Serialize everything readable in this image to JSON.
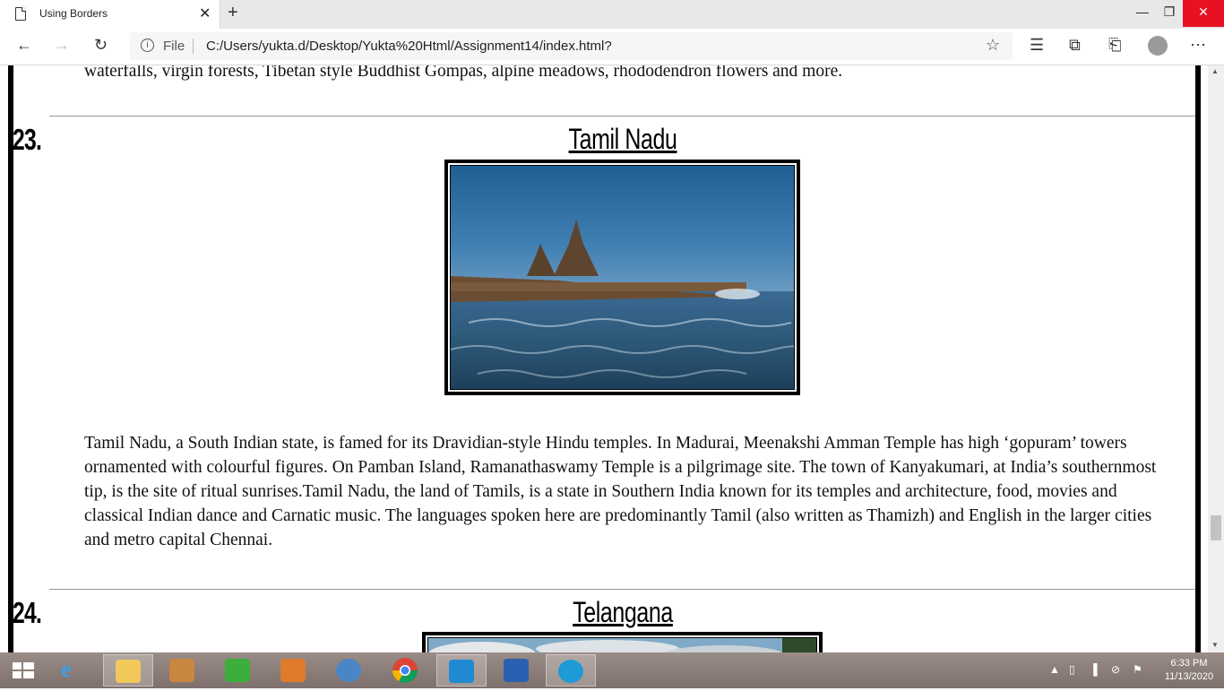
{
  "browser": {
    "tab_title": "Using Borders",
    "tab_close": "✕",
    "new_tab": "+",
    "scheme_label": "File",
    "url": "C:/Users/yukta.d/Desktop/Yukta%20Html/Assignment14/index.html?",
    "window_controls": {
      "minimize": "—",
      "maximize": "❐",
      "close": "✕"
    },
    "icons": [
      "back-icon",
      "forward-icon",
      "refresh-icon",
      "info-icon",
      "favorite-star-icon",
      "favorites-icon",
      "collections-icon",
      "share-icon",
      "profile-avatar",
      "more-icon"
    ]
  },
  "page": {
    "previous_text_tail": "waterfalls, virgin forests, Tibetan style Buddhist Gompas, alpine meadows, rhododendron flowers and more.",
    "sections": [
      {
        "number": "23.",
        "title": "Tamil Nadu",
        "image_alt": "Shore temple on the coast with sea waves",
        "description": "Tamil Nadu, a South Indian state, is famed for its Dravidian-style Hindu temples. In Madurai, Meenakshi Amman Temple has high ‘gopuram’ towers ornamented with colourful figures. On Pamban Island, Ramanathaswamy Temple is a pilgrimage site. The town of Kanyakumari, at India’s southernmost tip, is the site of ritual sunrises.Tamil Nadu, the land of Tamils, is a state in Southern India known for its temples and architecture, food, movies and classical Indian dance and Carnatic music. The languages spoken here are predominantly Tamil (also written as Thamizh) and English in the larger cities and metro capital Chennai."
      },
      {
        "number": "24.",
        "title": "Telangana",
        "image_alt": "Sky and clouds"
      }
    ]
  },
  "taskbar": {
    "apps": [
      "Start",
      "Internet Explorer",
      "File Explorer",
      "Media app",
      "Store",
      "Control Panel",
      "Math Input",
      "Chrome",
      "Visual Studio Code",
      "Word",
      "Edge"
    ],
    "time": "6:33 PM",
    "date": "11/13/2020"
  },
  "colors": {
    "accent_close": "#e81123",
    "page_border": "#000000",
    "taskbar": "#8b7e79"
  }
}
